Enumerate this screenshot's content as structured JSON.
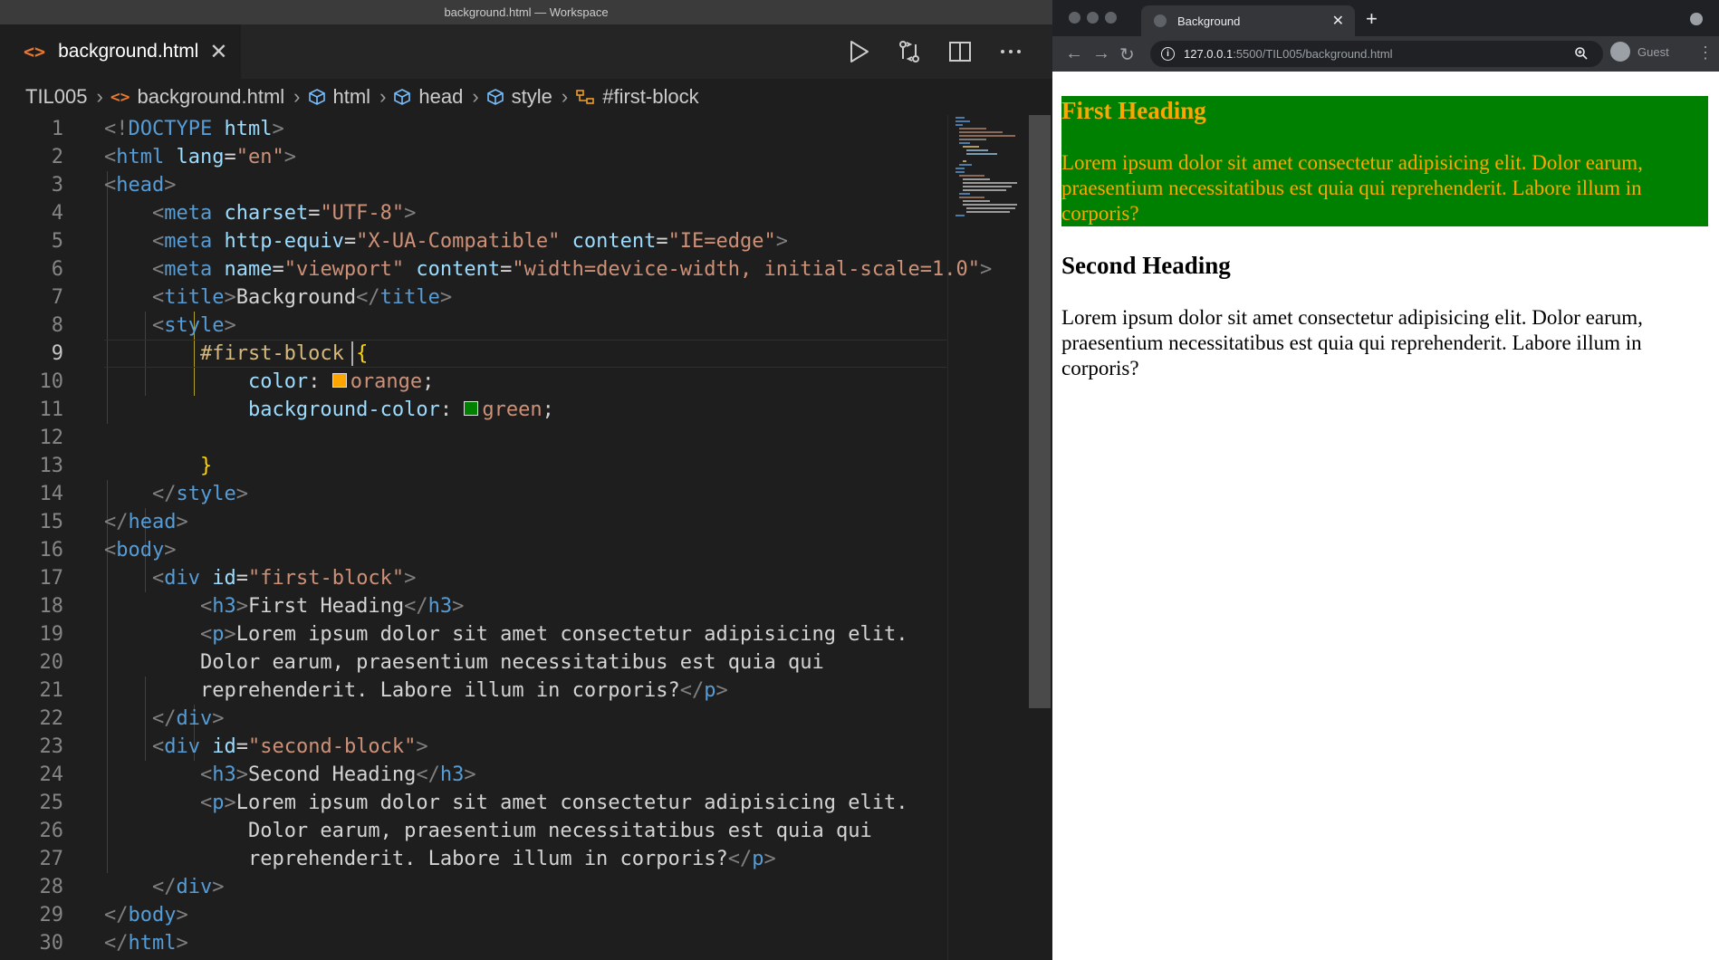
{
  "window_title": "background.html — Workspace",
  "editor": {
    "tab_label": "background.html",
    "breadcrumbs": [
      "TIL005",
      "background.html",
      "html",
      "head",
      "style",
      "#first-block"
    ],
    "line_numbers": [
      "1",
      "2",
      "3",
      "4",
      "5",
      "6",
      "7",
      "8",
      "9",
      "10",
      "11",
      "12",
      "13",
      "14",
      "15",
      "16",
      "17",
      "18",
      "19",
      "20",
      "21",
      "22",
      "23",
      "24",
      "25",
      "26",
      "27",
      "28",
      "29",
      "30"
    ],
    "code": {
      "l1": {
        "open": "<!",
        "doctype": "DOCTYPE",
        "html": "html",
        "close": ">"
      },
      "l2": {
        "tag": "html",
        "attr": "lang",
        "val": "\"en\""
      },
      "l3": {
        "tag": "head"
      },
      "l4": {
        "tag": "meta",
        "attr": "charset",
        "val": "\"UTF-8\""
      },
      "l5": {
        "tag": "meta",
        "attr1": "http-equiv",
        "val1": "\"X-UA-Compatible\"",
        "attr2": "content",
        "val2": "\"IE=edge\""
      },
      "l6": {
        "tag": "meta",
        "attr1": "name",
        "val1": "\"viewport\"",
        "attr2": "content",
        "val2": "\"width=device-width, initial-scale=1.0\""
      },
      "l7": {
        "tag": "title",
        "text": "Background"
      },
      "l8": {
        "tag": "style"
      },
      "l9": {
        "selector": "#first-block",
        "brace": "{"
      },
      "l10": {
        "prop": "color",
        "value": "orange",
        "swatch": "#ffa500"
      },
      "l11": {
        "prop": "background-color",
        "value": "green",
        "swatch": "#008000"
      },
      "l13": {
        "brace": "}"
      },
      "l14": {
        "tag": "style"
      },
      "l15": {
        "tag": "head"
      },
      "l16": {
        "tag": "body"
      },
      "l17": {
        "tag": "div",
        "attr": "id",
        "val": "\"first-block\""
      },
      "l18": {
        "tag": "h3",
        "text": "First Heading"
      },
      "l19": {
        "tag": "p",
        "text": "Lorem ipsum dolor sit amet consectetur adipisicing elit."
      },
      "l20": {
        "text": "Dolor earum, praesentium necessitatibus est quia qui"
      },
      "l21": {
        "text": "reprehenderit. Labore illum in corporis?",
        "tag": "p"
      },
      "l22": {
        "tag": "div"
      },
      "l23": {
        "tag": "div",
        "attr": "id",
        "val": "\"second-block\""
      },
      "l24": {
        "tag": "h3",
        "text": "Second Heading"
      },
      "l25": {
        "tag": "p",
        "text": "Lorem ipsum dolor sit amet consectetur adipisicing elit."
      },
      "l26": {
        "text": "Dolor earum, praesentium necessitatibus est quia qui"
      },
      "l27": {
        "text": "reprehenderit. Labore illum in corporis?",
        "tag": "p"
      },
      "l28": {
        "tag": "div"
      },
      "l29": {
        "tag": "body"
      },
      "l30": {
        "tag": "html"
      }
    }
  },
  "browser": {
    "tab_title": "Background",
    "url_host": "127.0.0.1",
    "url_rest": ":5500/TIL005/background.html",
    "profile_label": "Guest",
    "page": {
      "first_heading": "First Heading",
      "first_paragraph": "Lorem ipsum dolor sit amet consectetur adipisicing elit. Dolor earum, praesentium necessitatibus est quia qui reprehenderit. Labore illum in corporis?",
      "second_heading": "Second Heading",
      "second_paragraph": "Lorem ipsum dolor sit amet consectetur adipisicing elit. Dolor earum, praesentium necessitatibus est quia qui reprehenderit. Labore illum in corporis?"
    }
  },
  "colors": {
    "first_block_text": "#ffa500",
    "first_block_bg": "#008000",
    "editor_bg": "#1e1e1e"
  }
}
